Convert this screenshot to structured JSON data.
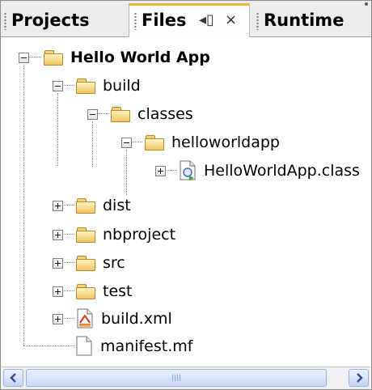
{
  "tabs": {
    "projects": "Projects",
    "files": "Files",
    "files_menu_glyph": "◂▯",
    "files_close_glyph": "×",
    "runtime": "Runtime"
  },
  "tree": {
    "root": {
      "label": "Hello World App",
      "expanded": true,
      "icon": "folder-icon"
    },
    "build": {
      "label": "build",
      "expanded": true,
      "icon": "folder-icon"
    },
    "classes": {
      "label": "classes",
      "expanded": true,
      "icon": "folder-icon"
    },
    "helloworldapp": {
      "label": "helloworldapp",
      "expanded": true,
      "icon": "folder-icon"
    },
    "helloworld_class": {
      "label": "HelloWorldApp.class",
      "expanded": false,
      "icon": "java-class-icon"
    },
    "dist": {
      "label": "dist",
      "expanded": false,
      "icon": "folder-icon"
    },
    "nbproject": {
      "label": "nbproject",
      "expanded": false,
      "icon": "folder-icon"
    },
    "src": {
      "label": "src",
      "expanded": false,
      "icon": "folder-icon"
    },
    "test": {
      "label": "test",
      "expanded": false,
      "icon": "folder-icon"
    },
    "build_xml": {
      "label": "build.xml",
      "expanded": false,
      "icon": "ant-xml-icon"
    },
    "manifest": {
      "label": "manifest.mf",
      "icon": "file-icon"
    }
  },
  "colors": {
    "active_tab_accent": "#f2b33c",
    "folder_fill": "#f1c55e",
    "scrollbar_blue": "#c3d3f5"
  }
}
